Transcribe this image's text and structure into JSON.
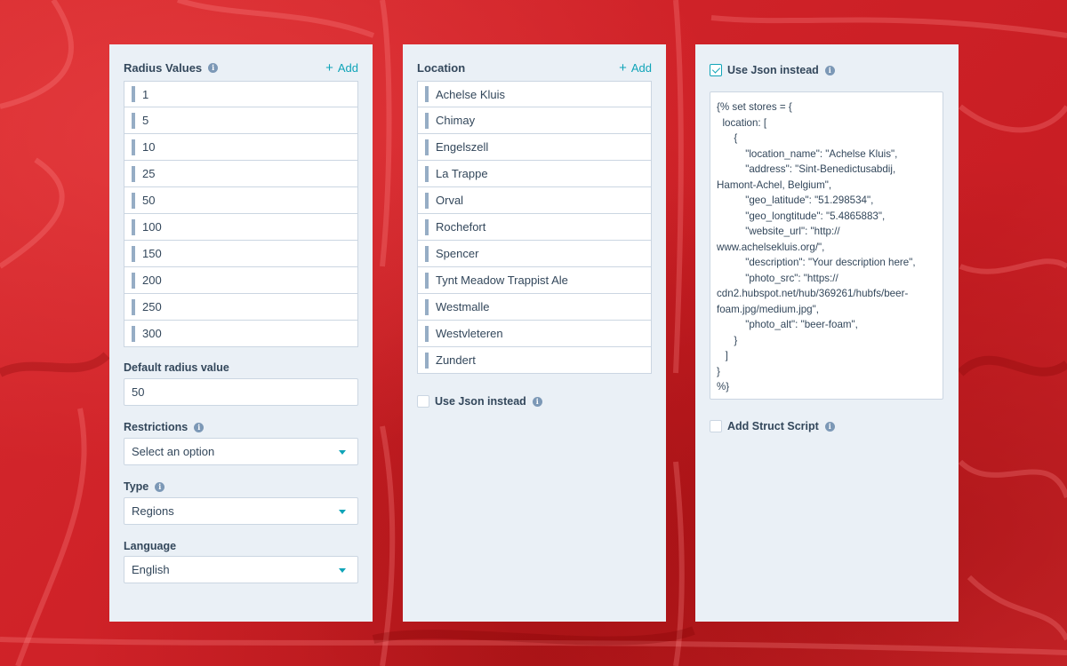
{
  "left_panel": {
    "radius_title": "Radius Values",
    "add_label": "Add",
    "radius_values": [
      "1",
      "5",
      "10",
      "25",
      "50",
      "100",
      "150",
      "200",
      "250",
      "300"
    ],
    "default_radius_label": "Default radius value",
    "default_radius_value": "50",
    "restrictions_label": "Restrictions",
    "restrictions_value": "Select an option",
    "type_label": "Type",
    "type_value": "Regions",
    "language_label": "Language",
    "language_value": "English"
  },
  "middle_panel": {
    "location_title": "Location",
    "add_label": "Add",
    "locations": [
      "Achelse Kluis",
      "Chimay",
      "Engelszell",
      "La Trappe",
      "Orval",
      "Rochefort",
      "Spencer",
      "Tynt Meadow Trappist Ale",
      "Westmalle",
      "Westvleteren",
      "Zundert"
    ],
    "use_json_label": "Use Json instead",
    "use_json_checked": false
  },
  "right_panel": {
    "use_json_label": "Use Json instead",
    "use_json_checked": true,
    "json_code": "{% set stores = {\n  location: [\n      {\n          \"location_name\": \"Achelse Kluis\",\n          \"address\": \"Sint-Benedictusabdij, Hamont-Achel, Belgium\",\n          \"geo_latitude\": \"51.298534\",\n          \"geo_longtitude\": \"5.4865883\",\n          \"website_url\": \"http:// www.achelsekluis.org/\",\n          \"description\": \"Your description here\",\n          \"photo_src\": \"https:// cdn2.hubspot.net/hub/369261/hubfs/beer-foam.jpg/medium.jpg\",\n          \"photo_alt\": \"beer-foam\",\n      }\n   ]\n}\n%}",
    "struct_script_label": "Add Struct Script",
    "struct_script_checked": false
  },
  "icons": {
    "info": "info-icon",
    "add": "plus-icon",
    "drag": "drag-handle-icon",
    "dropdown": "caret-down-icon",
    "check": "checkmark-icon"
  },
  "colors": {
    "background": "#d8262b",
    "panel": "#eaf0f6",
    "accent": "#0fa4b8",
    "text": "#33475b",
    "border": "#cbd6e2"
  }
}
